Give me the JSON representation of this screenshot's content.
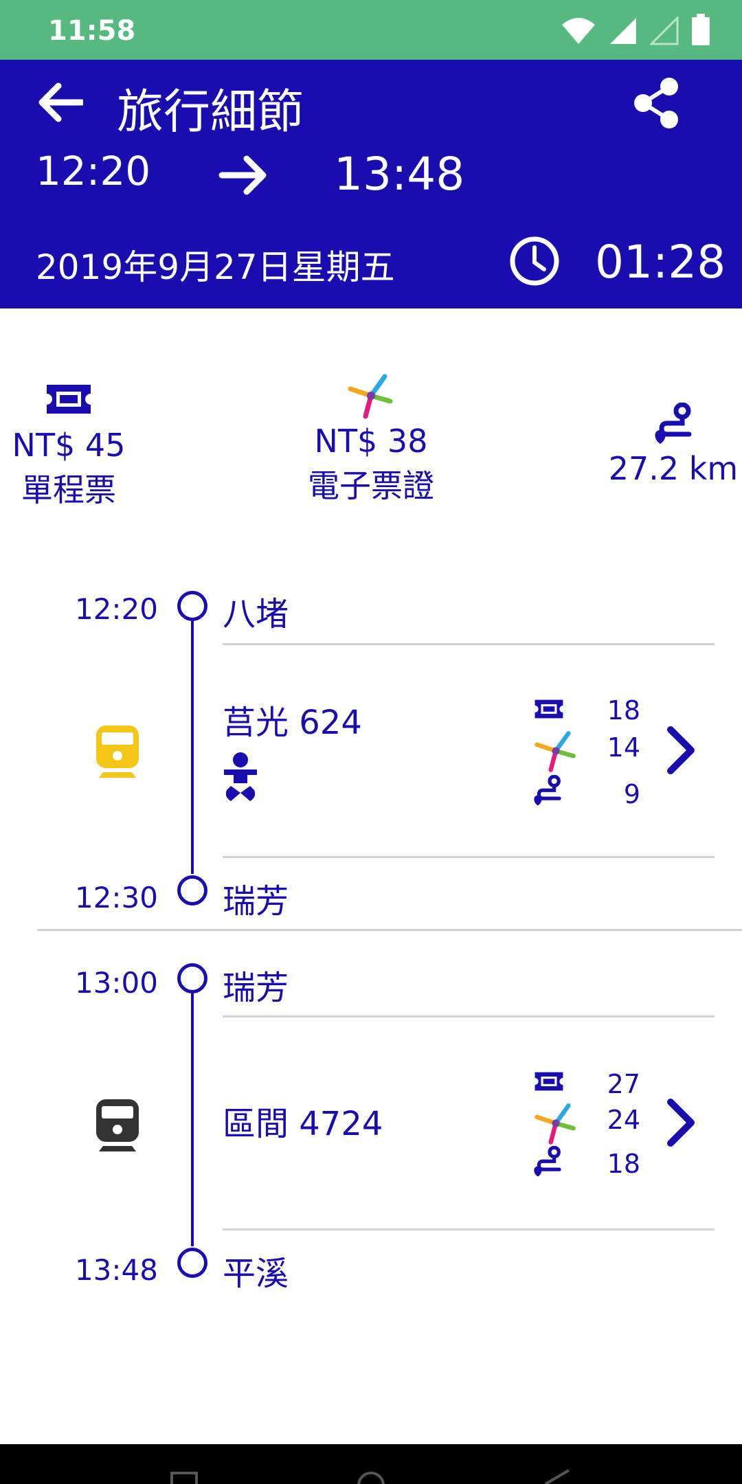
{
  "status": {
    "time": "11:58"
  },
  "header": {
    "title": "旅行細節",
    "depart": "12:20",
    "arrive": "13:48",
    "date": "2019年9月27日星期五",
    "duration": "01:28"
  },
  "summary": {
    "ticket_price": "NT$ 45",
    "ticket_label": "單程票",
    "ecard_price": "NT$ 38",
    "ecard_label": "電子票證",
    "distance": "27.2 km"
  },
  "legs": [
    {
      "depart_time": "12:20",
      "depart_station": "八堵",
      "train": "莒光 624",
      "fare_ticket": "18",
      "fare_ecard": "14",
      "distance": "9",
      "arrive_time": "12:30",
      "arrive_station": "瑞芳",
      "train_icon_color": "#f5c518"
    },
    {
      "depart_time": "13:00",
      "depart_station": "瑞芳",
      "train": "區間 4724",
      "fare_ticket": "27",
      "fare_ecard": "24",
      "distance": "18",
      "arrive_time": "13:48",
      "arrive_station": "平溪",
      "train_icon_color": "#333333"
    }
  ],
  "colors": {
    "primary": "#1a0db0",
    "status_bar": "#56b97e",
    "train_express": "#f5c518",
    "train_local": "#333333"
  }
}
